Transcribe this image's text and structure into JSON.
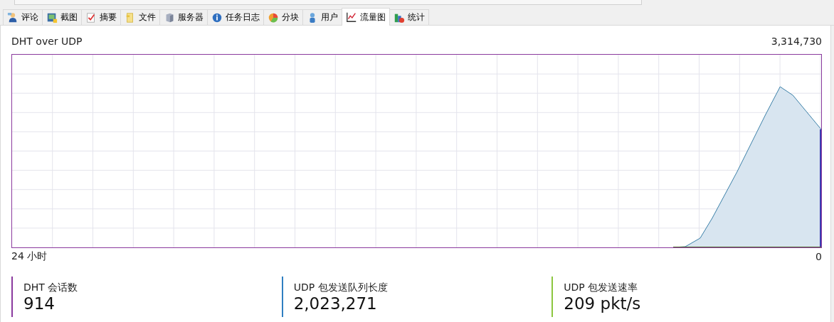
{
  "tabs": [
    {
      "label": "评论",
      "selected": false
    },
    {
      "label": "截图",
      "selected": false
    },
    {
      "label": "摘要",
      "selected": false
    },
    {
      "label": "文件",
      "selected": false
    },
    {
      "label": "服务器",
      "selected": false
    },
    {
      "label": "任务日志",
      "selected": false
    },
    {
      "label": "分块",
      "selected": false
    },
    {
      "label": "用户",
      "selected": false
    },
    {
      "label": "流量图",
      "selected": true
    },
    {
      "label": "统计",
      "selected": false
    }
  ],
  "graph": {
    "title": "DHT over UDP",
    "max_label": "3,314,730",
    "x_label": "24 小时",
    "min_label": "0"
  },
  "stats": [
    {
      "label": "DHT 会话数",
      "value": "914",
      "color": "#8b3a9e"
    },
    {
      "label": "UDP 包发送队列长度",
      "value": "2,023,271",
      "color": "#2f7fc1"
    },
    {
      "label": "UDP 包发送速率",
      "value": "209 pkt/s",
      "color": "#8cc63f"
    }
  ]
}
